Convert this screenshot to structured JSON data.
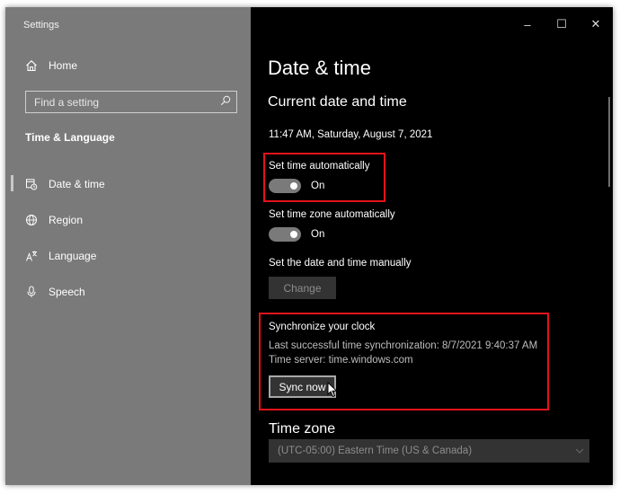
{
  "window": {
    "title": "Settings",
    "controls": {
      "minimize": "–",
      "maximize": "☐",
      "close": "✕"
    }
  },
  "sidebar": {
    "home_label": "Home",
    "search_placeholder": "Find a setting",
    "section": "Time & Language",
    "items": [
      {
        "label": "Date & time",
        "icon": "calendar-clock-icon",
        "active": true
      },
      {
        "label": "Region",
        "icon": "globe-icon",
        "active": false
      },
      {
        "label": "Language",
        "icon": "language-icon",
        "active": false
      },
      {
        "label": "Speech",
        "icon": "microphone-icon",
        "active": false
      }
    ]
  },
  "main": {
    "page_title": "Date & time",
    "section_title": "Current date and time",
    "current_datetime": "11:47 AM, Saturday, August 7, 2021",
    "set_time_auto": {
      "label": "Set time automatically",
      "state": "On"
    },
    "set_timezone_auto": {
      "label": "Set time zone automatically",
      "state": "On"
    },
    "manual": {
      "label": "Set the date and time manually",
      "button": "Change"
    },
    "sync": {
      "title": "Synchronize your clock",
      "last_sync": "Last successful time synchronization: 8/7/2021 9:40:37 AM",
      "server": "Time server: time.windows.com",
      "button": "Sync now"
    },
    "timezone": {
      "label": "Time zone",
      "value": "(UTC-05:00) Eastern Time (US & Canada)"
    }
  },
  "colors": {
    "sidebar_bg": "#7a7a7a",
    "content_bg": "#000000",
    "highlight": "#e3131b",
    "toggle_on": "#7a7a7a"
  }
}
